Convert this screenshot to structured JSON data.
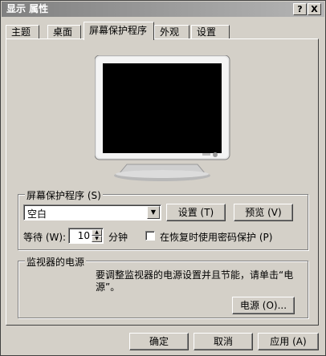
{
  "window": {
    "title": "显示 属性",
    "help_btn": "?",
    "close_btn": "X"
  },
  "tabs": [
    {
      "label": "主题"
    },
    {
      "label": "桌面"
    },
    {
      "label": "屏幕保护程序",
      "active": true
    },
    {
      "label": "外观"
    },
    {
      "label": "设置"
    }
  ],
  "screensaver": {
    "group_label": "屏幕保护程序 (S)",
    "selected": "空白",
    "settings_btn": "设置 (T)",
    "preview_btn": "预览 (V)",
    "wait_label": "等待 (W):",
    "wait_value": "10",
    "minutes_label": "分钟",
    "password_label": "在恢复时使用密码保护 (P)"
  },
  "power": {
    "group_label": "监视器的电源",
    "description": "要调整监视器的电源设置并且节能，请单击“电源”。",
    "power_btn": "电源 (O)..."
  },
  "footer": {
    "ok": "确定",
    "cancel": "取消",
    "apply": "应用 (A)"
  }
}
